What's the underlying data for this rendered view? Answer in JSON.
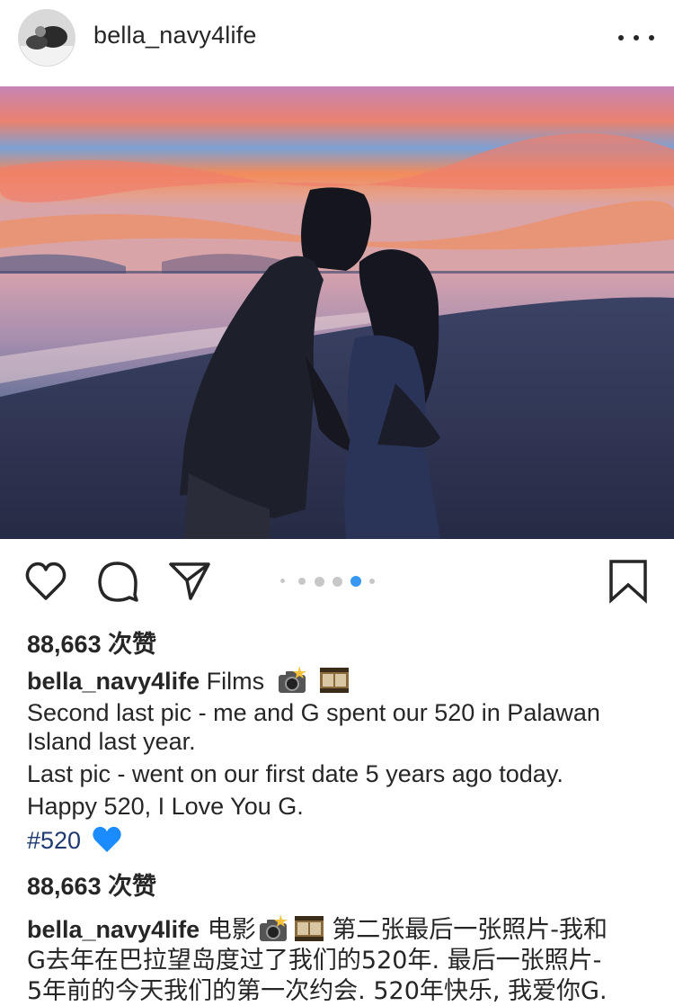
{
  "header": {
    "username": "bella_navy4life",
    "more_icon": "more-horizontal-icon"
  },
  "post": {
    "image_description_icon": "photo",
    "carousel": {
      "count": 5,
      "active_index": 3
    }
  },
  "actions": {
    "like_icon": "heart-icon",
    "comment_icon": "comment-icon",
    "share_icon": "send-icon",
    "save_icon": "bookmark-icon"
  },
  "likes_1": "88,663 次赞",
  "caption_en": {
    "username": "bella_navy4life",
    "title": "Films",
    "line1": "Second last pic - me and G spent our 520 in Palawan",
    "line2": "Island last year.",
    "line3": "Last pic - went on our first date 5 years ago today.",
    "line4": "Happy 520, I Love You G.",
    "hashtag": "#520"
  },
  "likes_2": "88,663 次赞",
  "caption_cn": {
    "username": "bella_navy4life",
    "word1": "电影",
    "line1_rest": "第二张最后一张照片-我和",
    "line2": "G去年在巴拉望岛度过了我们的520年. 最后一张照片-",
    "line3": "5年前的今天我们的第一次约会. 520年快乐, 我爱你G."
  },
  "colors": {
    "text": "#262626",
    "hashtag": "#1e3b70",
    "active_dot": "#3897f0",
    "inactive_dot": "#c7c7c7"
  }
}
